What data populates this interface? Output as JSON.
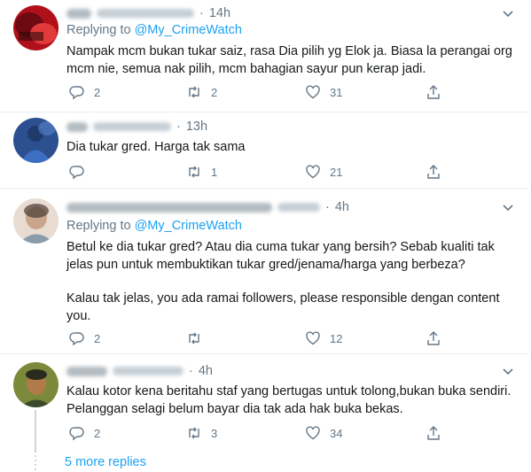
{
  "colors": {
    "accent": "#1da1f2",
    "muted": "#657786",
    "text": "#14171a",
    "border": "#e6ecf0"
  },
  "tweets": [
    {
      "time": "14h",
      "replying_prefix": "Replying to",
      "replying_handle": "@My_CrimeWatch",
      "text": [
        "Nampak mcm bukan tukar saiz, rasa Dia pilih yg Elok ja. Biasa la perangai org mcm nie, semua nak pilih, mcm bahagian sayur pun kerap jadi."
      ],
      "replies": "2",
      "retweets": "2",
      "likes": "31"
    },
    {
      "time": "13h",
      "text": [
        "Dia tukar gred. Harga tak sama"
      ],
      "replies": "",
      "retweets": "1",
      "likes": "21"
    },
    {
      "time": "4h",
      "replying_prefix": "Replying to",
      "replying_handle": "@My_CrimeWatch",
      "text": [
        "Betul ke dia tukar gred? Atau dia cuma tukar yang bersih? Sebab kualiti tak jelas pun untuk membuktikan tukar gred/jenama/harga yang berbeza?",
        "Kalau tak jelas, you ada ramai followers, please responsible dengan content you."
      ],
      "replies": "2",
      "retweets": "",
      "likes": "12"
    },
    {
      "time": "4h",
      "text": [
        "Kalau kotor kena beritahu staf yang bertugas untuk tolong,bukan buka sendiri. Pelanggan selagi belum bayar dia tak ada hak buka bekas."
      ],
      "replies": "2",
      "retweets": "3",
      "likes": "34"
    }
  ],
  "more_replies": "5 more replies",
  "icons": [
    "chevron-down-icon",
    "reply-icon",
    "retweet-icon",
    "like-icon",
    "share-icon"
  ]
}
